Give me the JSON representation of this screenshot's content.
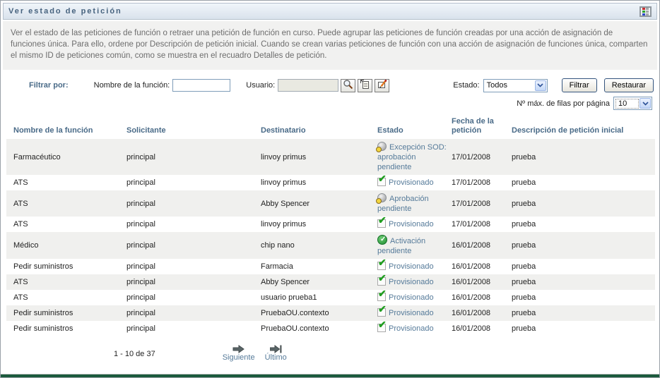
{
  "title_bar": {
    "title": "Ver estado de petición"
  },
  "description": "Ver el estado de las peticiones de función o retraer una petición de función en curso. Puede agrupar las peticiones de función creadas por una acción de asignación de funciones única. Para ello, ordene por Descripción de petición inicial. Cuando se crean varias peticiones de función con una acción de asignación de funciones única, comparten el mismo ID de peticiones común, como se muestra en el recuadro Detalles de petición.",
  "filter": {
    "filter_by_label": "Filtrar por:",
    "role_name_label": "Nombre de la función:",
    "role_name_value": "",
    "user_label": "Usuario:",
    "user_value": "",
    "state_label": "Estado:",
    "state_value": "Todos",
    "filter_button": "Filtrar",
    "restore_button": "Restaurar",
    "max_rows_label": "Nº máx. de filas por página",
    "max_rows_value": "10",
    "icons": [
      "search-icon",
      "history-icon",
      "clear-icon"
    ]
  },
  "table": {
    "columns": [
      "Nombre de la función",
      "Solicitante",
      "Destinatario",
      "Estado",
      "Fecha de la petición",
      "Descripción de petición inicial"
    ],
    "rows": [
      {
        "role": "Farmacéutico",
        "requester": "principal",
        "recipient": "linvoy primus",
        "status": "Excepción SOD: aprobación pendiente",
        "icon": "pending",
        "date": "17/01/2008",
        "description": "prueba"
      },
      {
        "role": "ATS",
        "requester": "principal",
        "recipient": "linvoy primus",
        "status": "Provisionado",
        "icon": "provisioned",
        "date": "17/01/2008",
        "description": "prueba"
      },
      {
        "role": "ATS",
        "requester": "principal",
        "recipient": "Abby Spencer",
        "status": "Aprobación pendiente",
        "icon": "pending",
        "date": "17/01/2008",
        "description": "prueba"
      },
      {
        "role": "ATS",
        "requester": "principal",
        "recipient": "linvoy primus",
        "status": "Provisionado",
        "icon": "provisioned",
        "date": "17/01/2008",
        "description": "prueba"
      },
      {
        "role": "Médico",
        "requester": "principal",
        "recipient": "chip nano",
        "status": "Activación pendiente",
        "icon": "activation",
        "date": "16/01/2008",
        "description": "prueba"
      },
      {
        "role": "Pedir suministros",
        "requester": "principal",
        "recipient": "Farmacia",
        "status": "Provisionado",
        "icon": "provisioned",
        "date": "16/01/2008",
        "description": "prueba"
      },
      {
        "role": "ATS",
        "requester": "principal",
        "recipient": "Abby Spencer",
        "status": "Provisionado",
        "icon": "provisioned",
        "date": "16/01/2008",
        "description": "prueba"
      },
      {
        "role": "ATS",
        "requester": "principal",
        "recipient": "usuario prueba1",
        "status": "Provisionado",
        "icon": "provisioned",
        "date": "16/01/2008",
        "description": "prueba"
      },
      {
        "role": "Pedir suministros",
        "requester": "principal",
        "recipient": "PruebaOU.contexto",
        "status": "Provisionado",
        "icon": "provisioned",
        "date": "16/01/2008",
        "description": "prueba"
      },
      {
        "role": "Pedir suministros",
        "requester": "principal",
        "recipient": "PruebaOU.contexto",
        "status": "Provisionado",
        "icon": "provisioned",
        "date": "16/01/2008",
        "description": "prueba"
      }
    ]
  },
  "pagination": {
    "range": "1 - 10 de 37",
    "next_label": "Siguiente",
    "last_label": "Último"
  },
  "colors": {
    "title_text": "#46627e",
    "header_text": "#4a6b88",
    "status_text": "#557a99",
    "row_alt": "#f0f0ee",
    "green_bar": "#1b5a3c",
    "provisioned_check": "#1f9e1f",
    "pending_clock": "#f2d53e",
    "activation_green": "#1f8f35"
  }
}
